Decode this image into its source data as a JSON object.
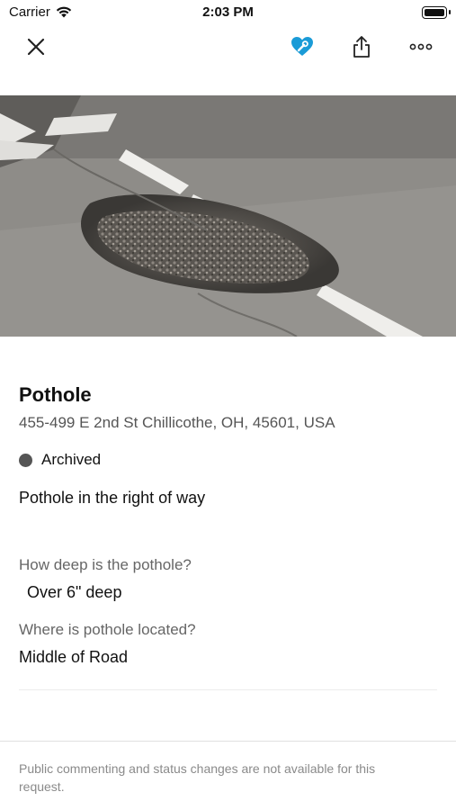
{
  "status_bar": {
    "carrier": "Carrier",
    "time": "2:03 PM"
  },
  "toolbar": {
    "close_icon": "close-icon",
    "favorite_icon": "heart-wrench-icon",
    "share_icon": "share-icon",
    "more_icon": "more-icon",
    "accent_color": "#1a9bd7"
  },
  "request": {
    "title": "Pothole",
    "address": "455-499 E 2nd St Chillicothe, OH, 45601, USA",
    "status": "Archived",
    "description": "Pothole in the right of way",
    "questions": [
      {
        "question": "How deep is the pothole?",
        "answer": " Over 6\" deep"
      },
      {
        "question": "Where is pothole located?",
        "answer": "Middle of Road"
      }
    ]
  },
  "footer": {
    "note": "Public commenting and status changes are not available for this request."
  }
}
